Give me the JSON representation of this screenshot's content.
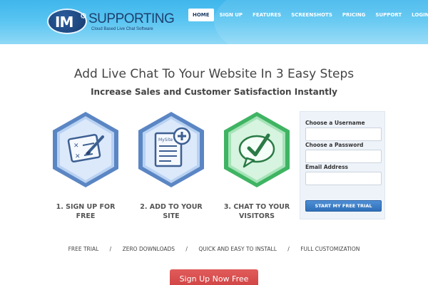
{
  "header": {
    "logo": {
      "mark": "IM",
      "name": "SUPPORTING",
      "tagline": "Cloud Based Live Chat Software"
    },
    "nav": [
      {
        "label": "HOME",
        "active": true
      },
      {
        "label": "SIGN UP",
        "active": false
      },
      {
        "label": "FEATURES",
        "active": false
      },
      {
        "label": "SCREENSHOTS",
        "active": false
      },
      {
        "label": "PRICING",
        "active": false
      },
      {
        "label": "SUPPORT",
        "active": false
      },
      {
        "label": "LOGIN",
        "active": false
      }
    ]
  },
  "hero": {
    "headline": "Add Live Chat To Your Website In 3 Easy Steps",
    "subheadline": "Increase Sales and Customer Satisfaction Instantly"
  },
  "steps": [
    {
      "line1": "1. SIGN UP FOR",
      "line2": "FREE",
      "icon": "signup-form-pen-icon"
    },
    {
      "line1": "2. ADD TO YOUR",
      "line2": "SITE",
      "icon": "add-document-icon",
      "doc_text": "MySite"
    },
    {
      "line1": "3. CHAT TO YOUR",
      "line2": "VISITORS",
      "icon": "chat-bubble-check-icon"
    }
  ],
  "form": {
    "username_label": "Choose a Username",
    "password_label": "Choose a Password",
    "email_label": "Email Address",
    "submit_label": "START MY FREE TRIAL"
  },
  "features": [
    "FREE TRIAL",
    "ZERO DOWNLOADS",
    "QUICK AND EASY TO INSTALL",
    "FULL CUSTOMIZATION"
  ],
  "feature_separator": "/",
  "cta": {
    "label": "Sign Up Now Free"
  },
  "colors": {
    "header_blue": "#3fb6ec",
    "nav_active_text": "#1c3d66",
    "step1_hex": "#6d9bd8",
    "step2_hex": "#6d9bd8",
    "step3_hex": "#5fcf7f",
    "form_button": "#3a7cc6",
    "cta_red": "#d84a4a"
  }
}
